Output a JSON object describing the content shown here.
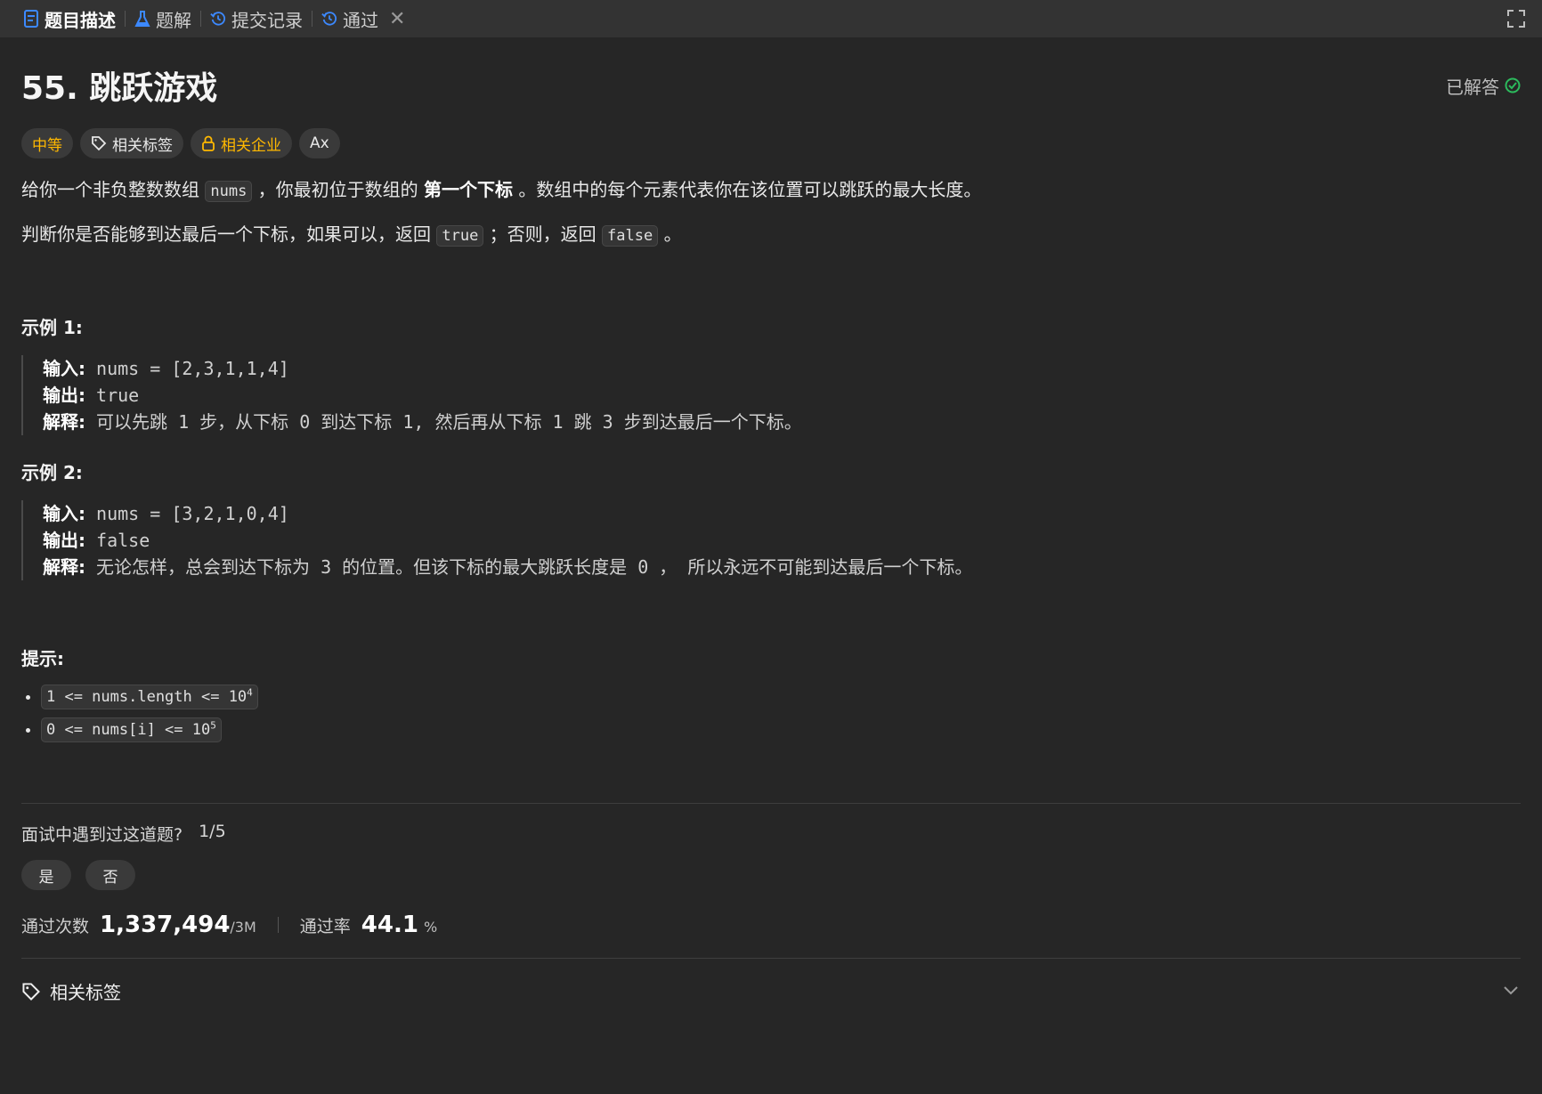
{
  "tabs": [
    {
      "label": "题目描述",
      "icon": "description-icon"
    },
    {
      "label": "题解",
      "icon": "flask-icon"
    },
    {
      "label": "提交记录",
      "icon": "history-icon"
    },
    {
      "label": "通过",
      "icon": "history-icon"
    }
  ],
  "title": "55. 跳跃游戏",
  "solved_label": "已解答",
  "tags": {
    "difficulty": "中等",
    "related_tags": "相关标签",
    "related_companies": "相关企业",
    "font": "Ax"
  },
  "description": {
    "p1_a": "给你一个非负整数数组",
    "p1_code": "nums",
    "p1_b": "，你最初位于数组的",
    "p1_bold": "第一个下标",
    "p1_c": "。数组中的每个元素代表你在该位置可以跳跃的最大长度。",
    "p2_a": "判断你是否能够到达最后一个下标，如果可以，返回",
    "p2_code1": "true",
    "p2_b": "；否则，返回",
    "p2_code2": "false",
    "p2_c": "。"
  },
  "examples": [
    {
      "title": "示例 1:",
      "input_label": "输入:",
      "input": "nums = [2,3,1,1,4]",
      "output_label": "输出:",
      "output": "true",
      "explain_label": "解释:",
      "explain": "可以先跳 1 步，从下标 0 到达下标 1, 然后再从下标 1 跳 3 步到达最后一个下标。"
    },
    {
      "title": "示例 2:",
      "input_label": "输入:",
      "input": "nums = [3,2,1,0,4]",
      "output_label": "输出:",
      "output": "false",
      "explain_label": "解释:",
      "explain": "无论怎样，总会到达下标为 3 的位置。但该下标的最大跳跃长度是 0 ， 所以永远不可能到达最后一个下标。"
    }
  ],
  "hints": {
    "title": "提示:",
    "items": [
      {
        "text": "1 <= nums.length <= 10",
        "sup": "4"
      },
      {
        "text": "0 <= nums[i] <= 10",
        "sup": "5"
      }
    ]
  },
  "interview": {
    "question": "面试中遇到过这道题?",
    "ratio": "1/5",
    "yes": "是",
    "no": "否"
  },
  "stats": {
    "accepted_label": "通过次数",
    "accepted_value": "1,337,494",
    "submissions_value": "/3M",
    "rate_label": "通过率",
    "rate_value": "44.1",
    "rate_unit": "%"
  },
  "related_section": {
    "label": "相关标签"
  },
  "colors": {
    "background": "#262626",
    "tabbar": "#333333",
    "accent_blue": "#3c89ff",
    "medium": "#ffb800",
    "solved_green": "#2cbb5d"
  }
}
